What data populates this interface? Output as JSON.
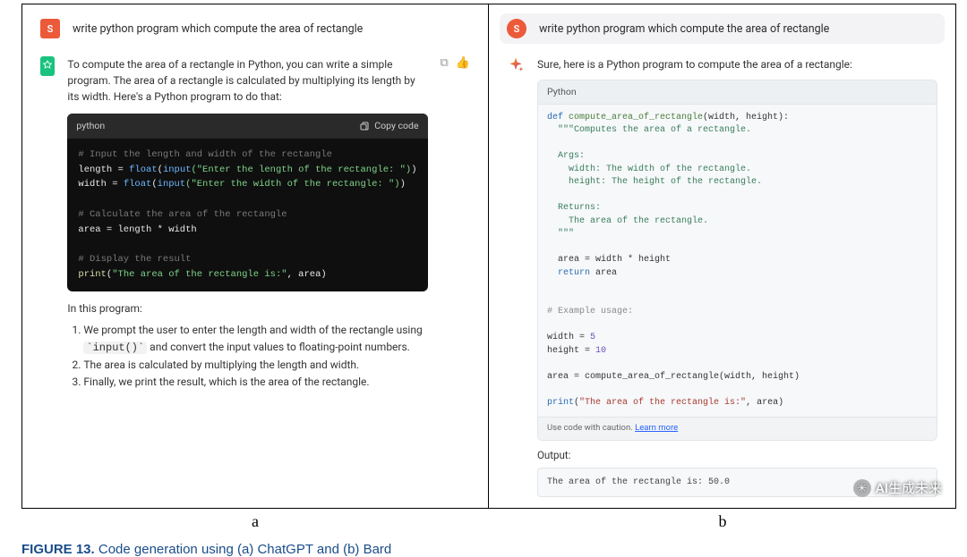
{
  "prompt": "write python program which compute the area of rectangle",
  "gpt": {
    "intro": "To compute the area of a rectangle in Python, you can write a simple program. The area of a rectangle is calculated by multiplying its length by its width. Here's a Python program to do that:",
    "lang_label": "python",
    "copy_label": "Copy code",
    "code": {
      "c1": "# Input the length and width of the rectangle",
      "l2a": "length",
      "l2eq": " = ",
      "l2fn": "float",
      "l2p": "(",
      "l2in": "input",
      "l2s": "(\"Enter the length of the rectangle: \")",
      "l2e": ")",
      "l3a": "width",
      "l3eq": " = ",
      "l3fn": "float",
      "l3p": "(",
      "l3in": "input",
      "l3s": "(\"Enter the width of the rectangle: \")",
      "l3e": ")",
      "c2": "# Calculate the area of the rectangle",
      "l5": "area = length * width",
      "c3": "# Display the result",
      "l7fn": "print",
      "l7p": "(",
      "l7s": "\"The area of the rectangle is:\"",
      "l7rest": ", area)"
    },
    "in_this_program": "In this program:",
    "li1a": "We prompt the user to enter the length and width of the rectangle using ",
    "li1code": "`input()`",
    "li1b": " and convert the input values to floating-point numbers.",
    "li2": "The area is calculated by multiplying the length and width.",
    "li3": "Finally, we print the result, which is the area of the rectangle."
  },
  "bard": {
    "intro": "Sure, here is a Python program to compute the area of a rectangle:",
    "lang_label": "Python",
    "code": {
      "l1a": "def ",
      "l1b": "compute_area_of_rectangle",
      "l1c": "(width, height):",
      "d1": "  \"\"\"Computes the area of a rectangle.",
      "d2": "",
      "d3": "  Args:",
      "d4": "    width: The width of the rectangle.",
      "d5": "    height: The height of the rectangle.",
      "d6": "",
      "d7": "  Returns:",
      "d8": "    The area of the rectangle.",
      "d9": "  \"\"\"",
      "l2": "  area = width * height",
      "l3a": "  return ",
      "l3b": "area",
      "c1": "# Example usage:",
      "l4a": "width = ",
      "l4b": "5",
      "l5a": "height = ",
      "l5b": "10",
      "l6": "area = compute_area_of_rectangle(width, height)",
      "l7a": "print",
      "l7b": "(",
      "l7c": "\"The area of the rectangle is:\"",
      "l7d": ", area)"
    },
    "caution": "Use code with caution. ",
    "learn_more": "Learn more",
    "output_label": "Output:",
    "output": "The area of the rectangle is: 50.0"
  },
  "labels": {
    "a": "a",
    "b": "b"
  },
  "caption_strong": "FIGURE 13.",
  "caption_rest": " Code generation using (a) ChatGPT and (b) Bard",
  "watermark": "AI生成未来"
}
